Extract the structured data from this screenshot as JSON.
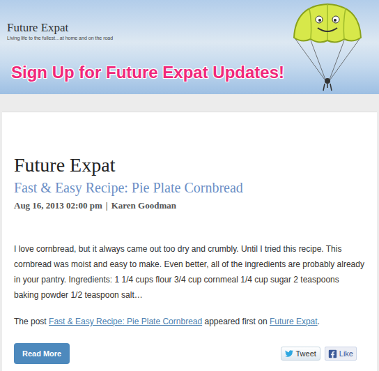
{
  "header": {
    "logo": "Future Expat",
    "tagline": "Living life to the fullest…at home and on the road",
    "banner": "Sign Up for Future Expat Updates!"
  },
  "feed_title": "Future Expat",
  "post": {
    "title": "Fast & Easy Recipe: Pie Plate Cornbread",
    "date": "Aug 16, 2013 02:00 pm",
    "separator": "|",
    "author": "Karen Goodman",
    "excerpt": "I love cornbread, but it always came out too dry and crumbly. Until I tried this recipe. This cornbread was moist and easy to make. Even better, all of the ingredients are probably already in your pantry. Ingredients: 1 1/4 cups flour 3/4 cup cornmeal 1/4 cup sugar 2 teaspoons baking powder 1/2 teaspoon salt…",
    "footer_prefix": "The post",
    "footer_link": "Fast & Easy Recipe: Pie Plate Cornbread",
    "footer_middle": "appeared first on",
    "footer_site": "Future Expat",
    "footer_suffix": "."
  },
  "buttons": {
    "read_more": "Read More",
    "tweet": "Tweet",
    "like": "Like"
  }
}
